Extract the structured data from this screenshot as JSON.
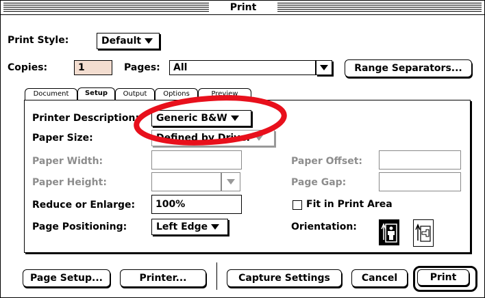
{
  "window": {
    "title": "Print"
  },
  "print_style": {
    "label": "Print Style:",
    "value": "Default"
  },
  "copies": {
    "label": "Copies:",
    "value": "1"
  },
  "pages": {
    "label": "Pages:",
    "value": "All"
  },
  "range_separators_button": "Range Separators...",
  "tabs": [
    {
      "label": "Document"
    },
    {
      "label": "Setup",
      "active": true
    },
    {
      "label": "Output"
    },
    {
      "label": "Options"
    },
    {
      "label": "Preview"
    }
  ],
  "setup": {
    "printer_description": {
      "label": "Printer Description:",
      "value": "Generic B&W"
    },
    "paper_size": {
      "label": "Paper Size:",
      "value": "Defined by Driver"
    },
    "paper_width": {
      "label": "Paper Width:",
      "value": ""
    },
    "paper_height": {
      "label": "Paper Height:",
      "value": ""
    },
    "paper_offset": {
      "label": "Paper Offset:",
      "value": ""
    },
    "page_gap": {
      "label": "Page Gap:",
      "value": ""
    },
    "reduce_enlarge": {
      "label": "Reduce or Enlarge:",
      "value": "100%"
    },
    "fit_in_print_area": {
      "label": "Fit in Print Area",
      "checked": false
    },
    "page_positioning": {
      "label": "Page Positioning:",
      "value": "Left Edge"
    },
    "orientation": {
      "label": "Orientation:",
      "options": [
        "portrait-icon",
        "landscape-icon"
      ],
      "selected": "portrait-icon"
    }
  },
  "annotation": {
    "color": "#e8101c"
  },
  "buttons": {
    "page_setup": "Page Setup...",
    "printer": "Printer...",
    "capture_settings": "Capture Settings",
    "cancel": "Cancel",
    "print": "Print"
  }
}
